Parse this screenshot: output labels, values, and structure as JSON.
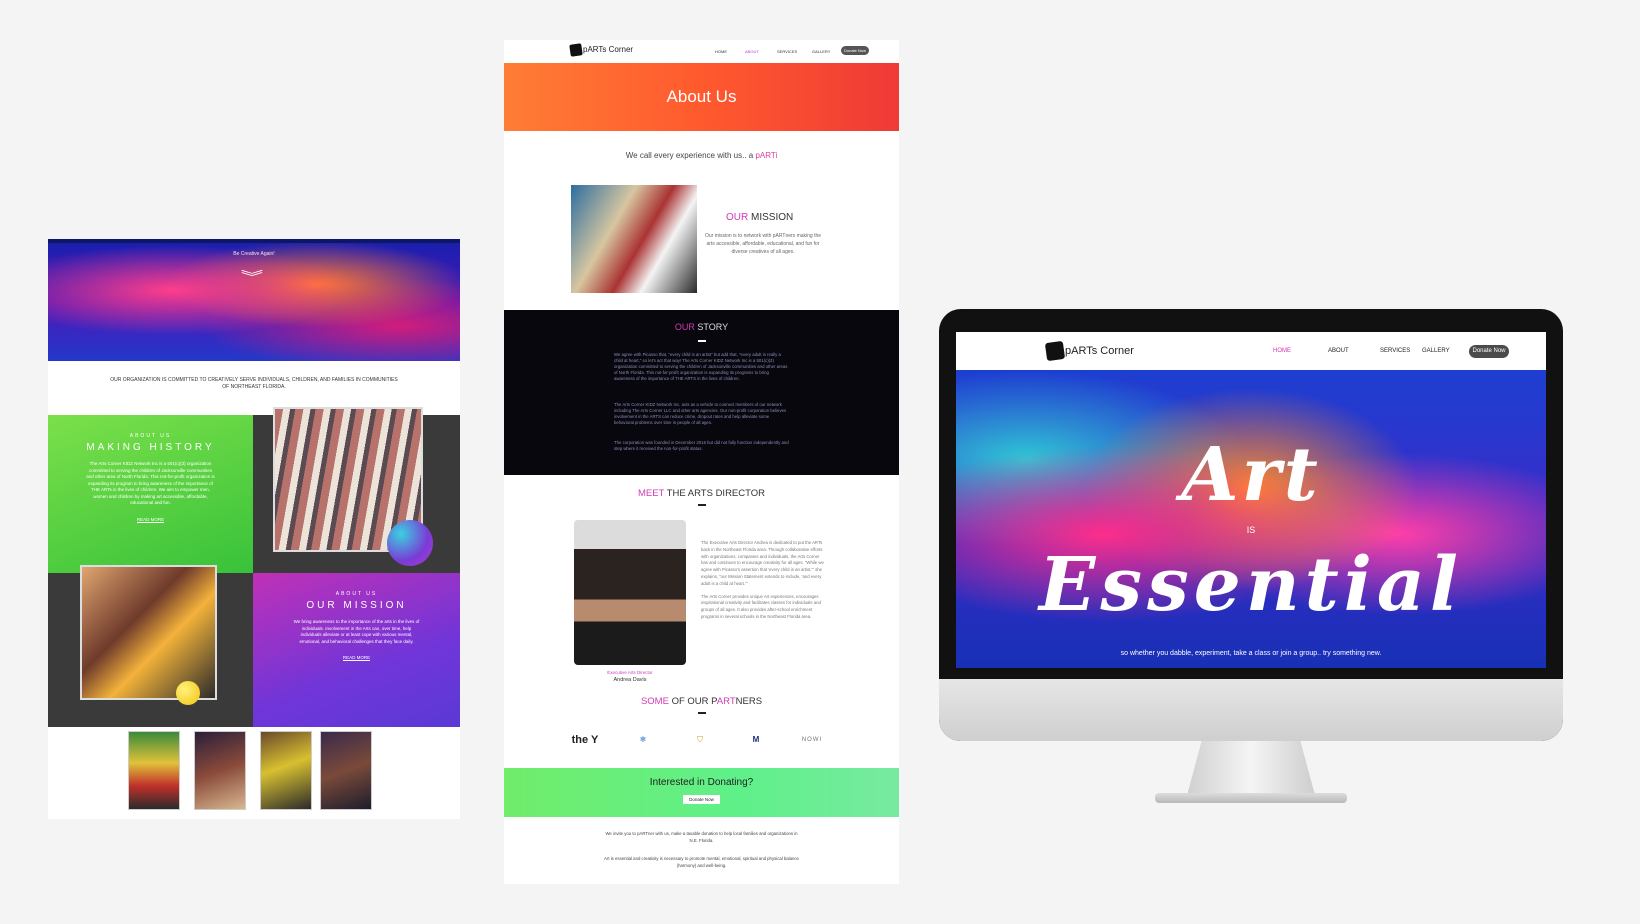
{
  "left": {
    "hero_tag": "Be Creative Again!",
    "commitment": "OUR ORGANIZATION IS COMMITTED TO CREATIVELY SERVE INDIVIDUALS, CHILDREN, AND FAMILIES IN COMMUNITIES OF NORTHEAST FLORIDA.",
    "history": {
      "kicker": "ABOUT US",
      "heading": "MAKING HISTORY",
      "body": "The Arts Corner KIDZ Network Inc is a 501(c)(3) organization committed to serving the children of Jacksonville communities and other area of North Florida. This not-for-profit organization is expanding its program to bring awareness of the importance of THE ARTs in the lives of children. We aim to empower men, women and children by making art accessible, affordable, educational and fun.",
      "read_more": "READ MORE"
    },
    "mission": {
      "kicker": "ABOUT US",
      "heading": "OUR MISSION",
      "body": "We bring awareness to the importance of the arts in the lives of individuals. Involvement in the Arts can, over time, help individuals alleviate or at least cope with various mental, emotional, and behavioral challenges that they face daily.",
      "read_more": "READ MORE"
    }
  },
  "center": {
    "brand": "pARTs Corner",
    "nav": {
      "home": "HOME",
      "about": "ABOUT",
      "services": "SERVICES",
      "gallery": "GALLERY",
      "donate": "Donate Now"
    },
    "banner_title": "About Us",
    "tagline": "We call every experience with us.. a",
    "tagline_hl": "pARTi",
    "mission": {
      "heading_hl": "OUR",
      "heading": " MISSION",
      "body": "Our mission is to network with pARTners making the arts accessible, affordable, educational, and fun for diverse creatives of all ages."
    },
    "story": {
      "heading_hl": "OUR",
      "heading": " STORY",
      "p1": "We agree with Picasso that, \"every child is an artist\" but add that, \"every adult is really a child at heart,\" so let's act that way! The Arts Corner KIDZ Network Inc is a 501(c)(3) organization committed to serving the children of Jacksonville communities and other areas of North Florida. This not-for-profit organization is expanding its programs to bring awareness of the importance of THE ARTS in the lives of children.",
      "p2": "The Arts Corner KIDZ Network Inc. acts as a vehicle to connect members of our network including The Arts Corner LLC and other arts agencies. Our non-profit corporation believes involvement in the ARTS can reduce crime, dropout rates and help alleviate some behavioral problems over time in people of all ages.",
      "p3": "The corporation was founded in December 2016 but did not fully function independently and step where it received the non-for-profit status."
    },
    "director": {
      "heading_hl": "MEET",
      "heading": " THE ARTS DIRECTOR",
      "title": "Executive Arts Director",
      "name": "Andrea Davis",
      "p1": "The Executive Arts Director Andrea is dedicated to put the ARTs back in the Northeast Florida area. Through collaborative efforts with organizations, companies and individuals, the Arts Corner has and continues to encourage creativity for all ages. \"While we agree with Picasso's assertion that 'every child is an artist,'\" she explains, \"our Mission Statement extends to include, 'and every adult is a child at heart.'\"",
      "p2": "The Arts Corner provides unique Art experiences, encourages inspirational creativity and facilitates classes for individuals and groups of all ages. It also provides after-school enrichment programs in several schools in the Northeast Florida area."
    },
    "partners": {
      "heading_hl": "SOME",
      "heading_mid": " OF OUR P",
      "heading_art": "ART",
      "heading_end": "NERS",
      "logos": [
        "the Y",
        "snowflake",
        "crest",
        "M",
        "NOWI"
      ]
    },
    "donate": {
      "question": "Interested in Donating?",
      "button": "Donate Now",
      "p1": "We invite you to pARTner with us, make a taxable donation to help local families and organizations in N.E. Florida.",
      "p2": "Art is essential and creativity is necessary to promote mental, emotional, spiritual and physical balance (harmony) and well-being."
    }
  },
  "right": {
    "brand": "pARTs Corner",
    "nav": {
      "home": "HOME",
      "about": "ABOUT",
      "services": "SERVICES",
      "gallery": "GALLERY",
      "donate": "Donate Now"
    },
    "hero_art": "Art",
    "hero_is": "IS",
    "hero_essential": "Essential",
    "hero_sub": "so whether you dabble, experiment, take a class or join a group.. try something new."
  }
}
